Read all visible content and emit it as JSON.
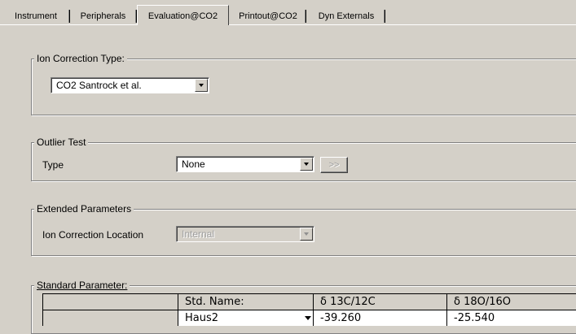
{
  "tabs": [
    {
      "label": "Instrument"
    },
    {
      "label": "Peripherals"
    },
    {
      "label": "Evaluation@CO2",
      "active": true
    },
    {
      "label": "Printout@CO2"
    },
    {
      "label": "Dyn Externals"
    }
  ],
  "ion_correction": {
    "group_title": "Ion Correction Type:",
    "selected": "CO2 Santrock et al."
  },
  "outlier_test": {
    "group_title": "Outlier Test",
    "type_label": "Type",
    "selected": "None",
    "more_button": ">>"
  },
  "extended_parameters": {
    "group_title": "Extended Parameters",
    "location_label": "Ion Correction Location",
    "selected": "Internal",
    "disabled": true
  },
  "standard_parameter": {
    "group_title": "Standard Parameter:",
    "columns": [
      "",
      "Std. Name:",
      "δ 13C/12C",
      "δ 18O/16O"
    ],
    "rows": [
      {
        "row_header": "",
        "std_name": "Haus2",
        "d13c": "-39.260",
        "d18o": "-25.540"
      }
    ]
  },
  "colors": {
    "face": "#d4d0c8",
    "shadow": "#808080",
    "highlight": "#ffffff"
  }
}
